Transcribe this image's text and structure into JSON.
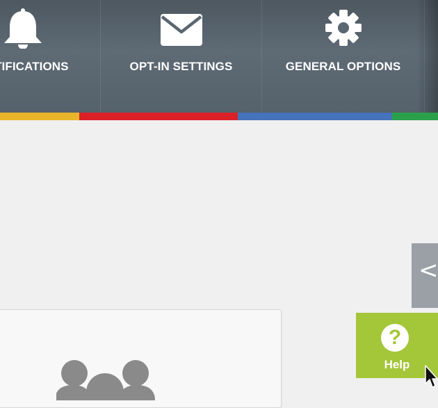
{
  "nav": {
    "items": [
      {
        "label": "NOTIFICATIONS",
        "icon": "bell-icon"
      },
      {
        "label": "OPT-IN SETTINGS",
        "icon": "envelope-icon"
      },
      {
        "label": "GENERAL OPTIONS",
        "icon": "gear-icon"
      }
    ]
  },
  "color_bar": [
    "#e9b52b",
    "#da2128",
    "#4573ba",
    "#2ba04a"
  ],
  "embed_tab": {
    "label": "</",
    "icon": "code-icon"
  },
  "help": {
    "label": "Help",
    "glyph": "?",
    "icon": "question-icon"
  },
  "card": {
    "icon": "users-group-icon"
  },
  "colors": {
    "nav_bg": "#5a6670",
    "help_bg": "#a4c639",
    "page_bg": "#f0f0f0"
  }
}
